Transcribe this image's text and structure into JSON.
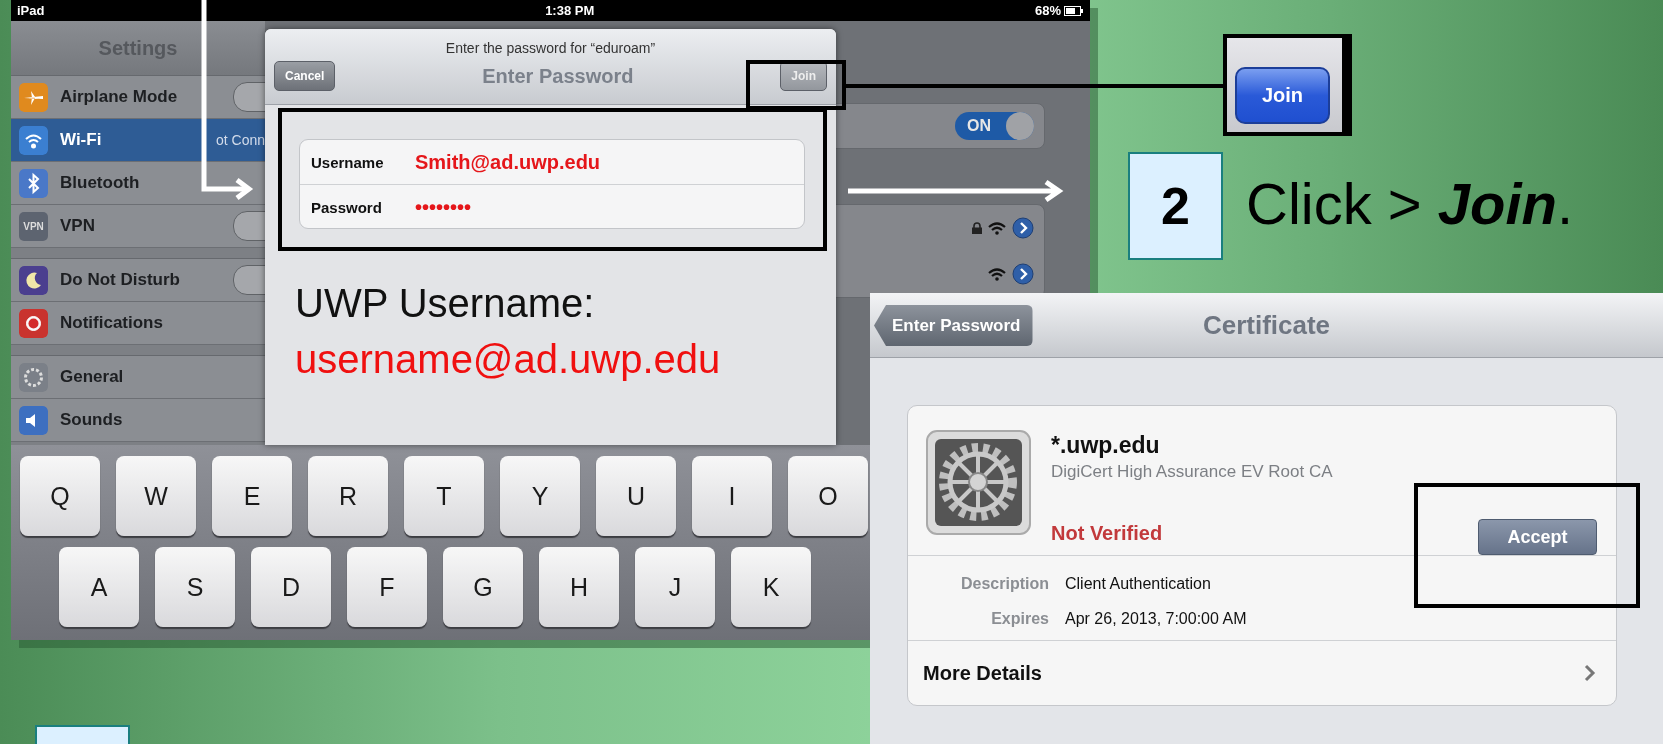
{
  "ipad_screen": {
    "status_bar": {
      "carrier": "iPad",
      "time": "1:38 PM",
      "battery": "68%"
    },
    "settings": {
      "title": "Settings",
      "groups": [
        {
          "items": [
            {
              "label": "Airplane Mode",
              "kind": "toggle",
              "on": false,
              "selected": false
            },
            {
              "label": "Wi-Fi",
              "kind": "value",
              "value": "ot Conn",
              "selected": true
            },
            {
              "label": "Bluetooth",
              "kind": "plain",
              "selected": false
            },
            {
              "label": "VPN",
              "badge": "VPN",
              "kind": "toggle",
              "on": false,
              "selected": false
            }
          ]
        },
        {
          "items": [
            {
              "label": "Do Not Disturb",
              "kind": "toggle",
              "on": false,
              "selected": false
            },
            {
              "label": "Notifications",
              "kind": "plain",
              "selected": false
            }
          ]
        },
        {
          "items": [
            {
              "label": "General",
              "kind": "plain",
              "selected": false
            },
            {
              "label": "Sounds",
              "kind": "plain",
              "selected": false
            }
          ]
        }
      ]
    },
    "wifi_panel": {
      "toggle": {
        "label": "ON",
        "on": true
      },
      "networks": [
        {
          "locked": true
        },
        {
          "locked": false
        }
      ]
    },
    "password_dialog": {
      "prompt": "Enter the password for “eduroam”",
      "cancel": "Cancel",
      "title": "Enter Password",
      "join": "Join",
      "fields": [
        {
          "label": "Username",
          "value": "Smith@ad.uwp.edu"
        },
        {
          "label": "Password",
          "value": "••••••••"
        }
      ]
    },
    "keyboard": {
      "rows": [
        [
          "Q",
          "W",
          "E",
          "R",
          "T",
          "Y",
          "U",
          "I",
          "O"
        ],
        [
          "A",
          "S",
          "D",
          "F",
          "G",
          "H",
          "J",
          "K"
        ]
      ]
    }
  },
  "note": {
    "label": "UWP Username:",
    "value": "username@ad.uwp.edu"
  },
  "join_zoom": {
    "button": "Join"
  },
  "step": {
    "number": "2",
    "instruction": "Click > **Join**."
  },
  "certificate": {
    "back": "Enter Password",
    "title": "Certificate",
    "name": "*.uwp.edu",
    "issuer": "DigiCert High Assurance EV Root CA",
    "status": "Not Verified",
    "accept": "Accept",
    "details": [
      {
        "label": "Description",
        "value": "Client Authentication"
      },
      {
        "label": "Expires",
        "value": "Apr 26, 2013, 7:00:00 AM"
      }
    ],
    "more": "More Details"
  }
}
